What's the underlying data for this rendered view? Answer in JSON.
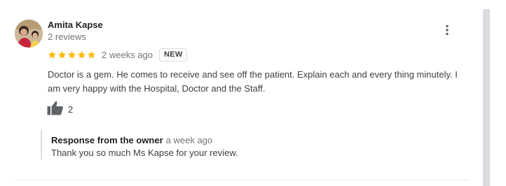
{
  "review": {
    "author_name": "Amita Kapse",
    "review_count": "2 reviews",
    "rating": 5,
    "rating_max": 5,
    "time": "2 weeks ago",
    "badge": "NEW",
    "text": "Doctor is a gem. He comes to receive and see off the patient. Explain each and every thing minutely. I am very happy with the Hospital, Doctor and the Staff.",
    "likes": "2",
    "star_color": "#fbbc04"
  },
  "owner_response": {
    "title": "Response from the owner",
    "time": "a week ago",
    "text": "Thank you so much Ms Kapse for your review."
  },
  "icons": {
    "menu": "more-vert-icon",
    "like": "thumb-up-icon",
    "star": "star-icon"
  }
}
